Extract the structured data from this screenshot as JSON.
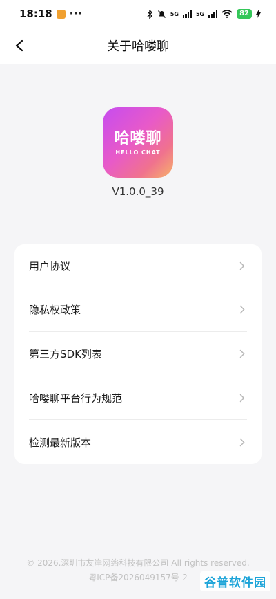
{
  "status_bar": {
    "time": "18:18",
    "dots": "···",
    "network_a": "5G",
    "network_b": "5G",
    "battery": "82"
  },
  "nav": {
    "title": "关于哈喽聊"
  },
  "logo": {
    "text_cn": "哈喽聊",
    "text_en": "HELLO CHAT"
  },
  "version": "V1.0.0_39",
  "menu": {
    "items": [
      {
        "label": "用户协议"
      },
      {
        "label": "隐私权政策"
      },
      {
        "label": "第三方SDK列表"
      },
      {
        "label": "哈喽聊平台行为规范"
      },
      {
        "label": "检测最新版本"
      }
    ]
  },
  "footer": {
    "copyright": "© 2026.深圳市友岸网络科技有限公司 All rights reserved.",
    "icp": "粤ICP备2026049157号-2"
  },
  "watermark": "谷普软件园",
  "colors": {
    "background": "#f5f5f7",
    "battery": "#34c759",
    "watermark": "#1aa3d8"
  }
}
